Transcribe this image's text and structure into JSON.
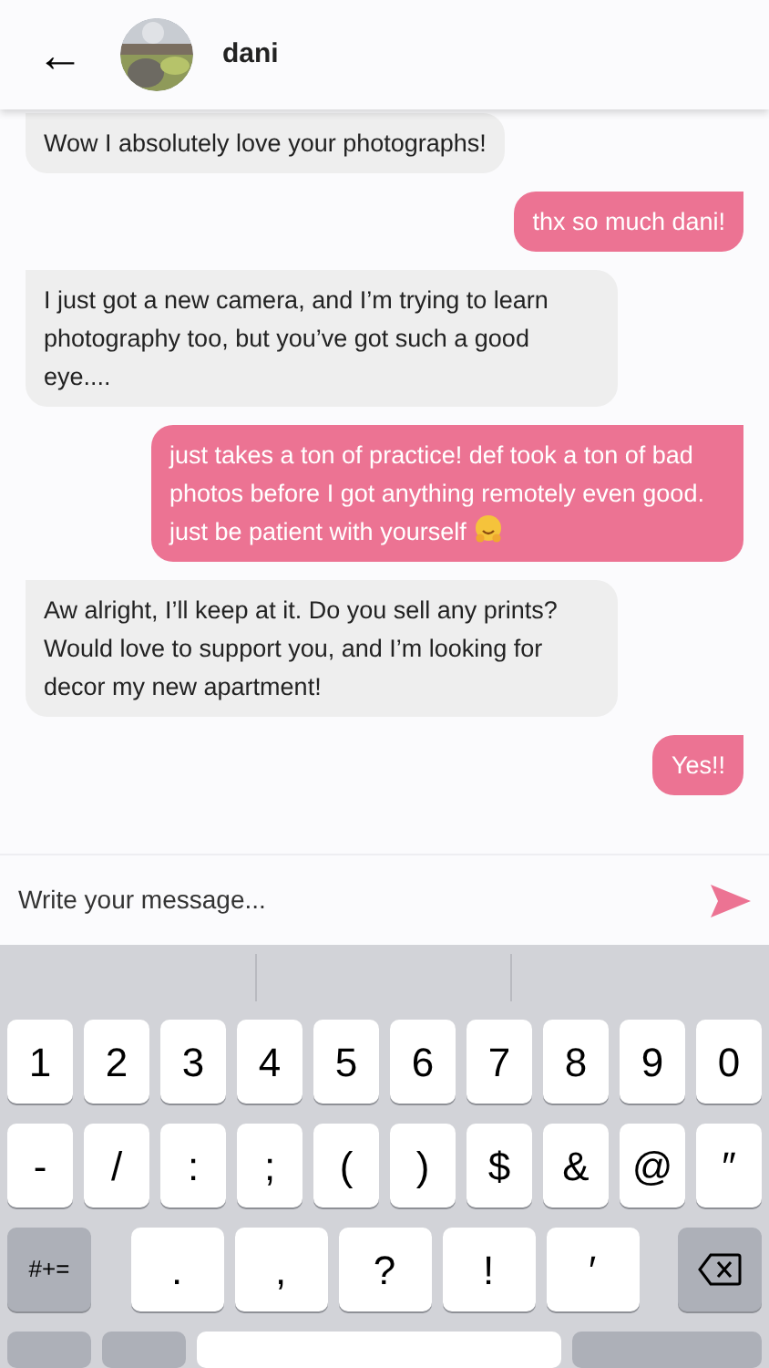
{
  "header": {
    "back": "←",
    "name": "dani"
  },
  "messages": [
    {
      "kind": "incoming",
      "text": "Wow I absolutely love your photographs!"
    },
    {
      "kind": "outgoing",
      "text": "thx so much dani!"
    },
    {
      "kind": "incoming",
      "text": "I just got a new camera, and I’m trying to learn photography too, but you’ve got such a good eye...."
    },
    {
      "kind": "outgoing",
      "text": "just takes a ton of practice! def took a ton of bad photos before I got anything remotely even good. just be patient with yourself",
      "emoji": true
    },
    {
      "kind": "incoming",
      "text": "Aw alright, I’ll keep at it. Do you sell any prints? Would love to support you, and I’m looking for decor my new apartment!"
    },
    {
      "kind": "outgoing",
      "text": "Yes!!"
    }
  ],
  "composer": {
    "placeholder": "Write your message..."
  },
  "keyboard": {
    "rows": [
      [
        "1",
        "2",
        "3",
        "4",
        "5",
        "6",
        "7",
        "8",
        "9",
        "0"
      ],
      [
        "-",
        "/",
        ":",
        ";",
        "(",
        ")",
        "$",
        "&",
        "@",
        "″"
      ],
      [
        "#+=",
        ".",
        ",",
        "?",
        "!",
        "′"
      ]
    ]
  }
}
